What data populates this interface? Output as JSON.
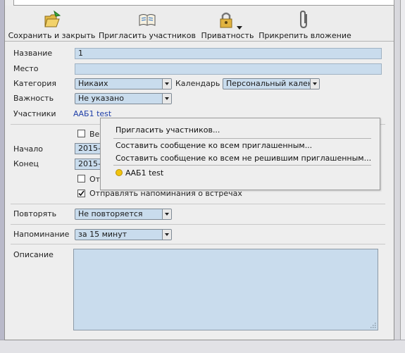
{
  "toolbar": {
    "save_close": "Сохранить и закрыть",
    "invite": "Пригласить участников",
    "privacy": "Приватность",
    "attach": "Прикрепить вложение"
  },
  "form": {
    "title_label": "Название",
    "title_value": "1",
    "location_label": "Место",
    "location_value": "",
    "category_label": "Категория",
    "category_value": "Никаих",
    "calendar_label": "Календарь",
    "calendar_value": "Персональный кален",
    "priority_label": "Важность",
    "priority_value": "Не указано",
    "attendees_label": "Участники",
    "attendees_value": "ААБ1 test",
    "start_label": "Начало",
    "start_value": "2015-",
    "end_label": "Конец",
    "end_value": "2015-",
    "allday_partial": "Ве",
    "partial_label": "От",
    "reminders_checkbox": "Отправлять напоминания о встречах",
    "repeat_label": "Повторять",
    "repeat_value": "Не повторяется",
    "reminder_label": "Напоминание",
    "reminder_value": "за 15 минут",
    "description_label": "Описание"
  },
  "popup": {
    "invite": "Пригласить участников...",
    "compose_all": "Составить сообщение ко всем приглашенным...",
    "compose_undecided": "Составить сообщение ко всем не решившим приглашенным...",
    "attendee": "ААБ1 test"
  },
  "colors": {
    "field_bg": "#c9dced",
    "link": "#1f3fa8",
    "attendee_status": "#f1c40f"
  }
}
